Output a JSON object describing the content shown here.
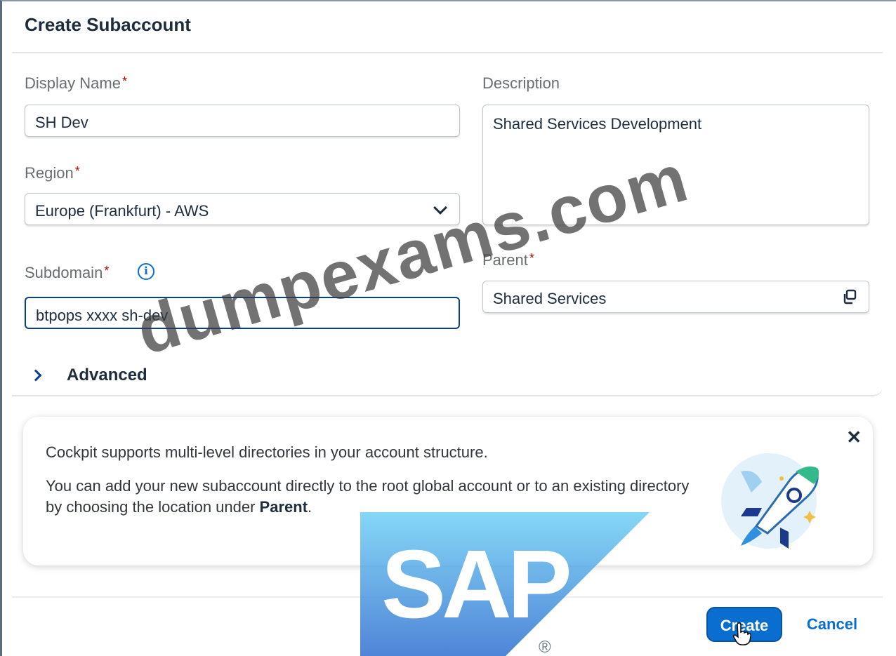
{
  "dialog": {
    "title": "Create Subaccount"
  },
  "form": {
    "display_name": {
      "label": "Display Name",
      "required_mark": "*",
      "value": "SH Dev"
    },
    "region": {
      "label": "Region",
      "required_mark": "*",
      "value": "Europe (Frankfurt) - AWS"
    },
    "subdomain": {
      "label": "Subdomain",
      "required_mark": "*",
      "value": "btpops  xxxx sh-dev"
    },
    "description": {
      "label": "Description",
      "value": "Shared Services Development"
    },
    "parent": {
      "label": "Parent",
      "required_mark": "*",
      "value": "Shared Services"
    }
  },
  "advanced": {
    "label": "Advanced"
  },
  "info_card": {
    "line1": "Cockpit supports multi-level directories in your account structure.",
    "line2_prefix": "You can add your new subaccount directly to the root global account or to an existing directory by choosing the location under ",
    "line2_bold": "Parent",
    "line2_suffix": "."
  },
  "footer": {
    "create_label": "Create",
    "cancel_label": "Cancel"
  },
  "logo": {
    "text": "SAP",
    "registered": "®"
  },
  "watermark": {
    "text": "dumpexams.com"
  },
  "colors": {
    "accent": "#0a6ed1",
    "required": "#aa0808",
    "focus_border": "#0a3f8f"
  },
  "icons": {
    "info": "info-icon",
    "copy": "copy-icon",
    "dropdown": "chevron-down-icon",
    "expand": "chevron-right-icon",
    "close": "close-icon",
    "rocket": "rocket-illustration"
  }
}
